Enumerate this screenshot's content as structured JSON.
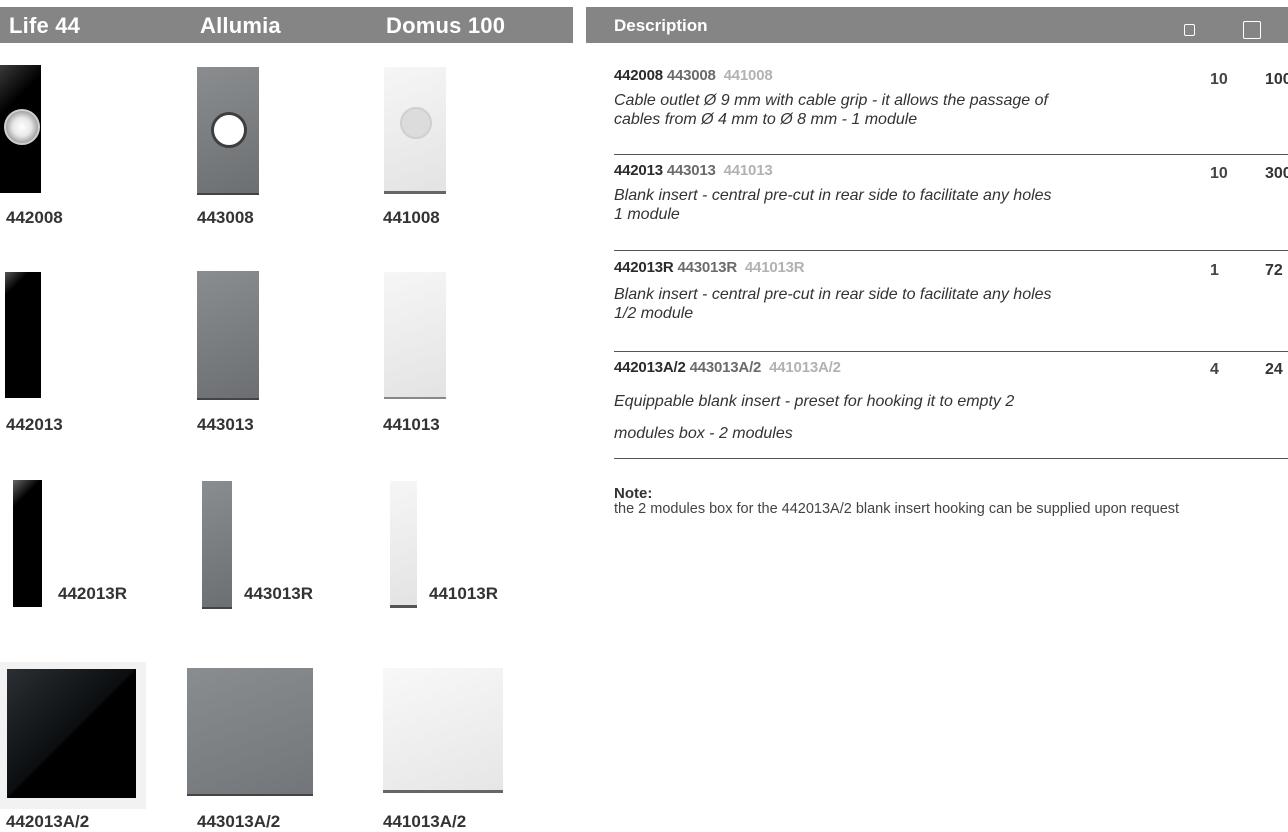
{
  "header": {
    "columns": [
      "Life 44",
      "Allumia",
      "Domus 100"
    ],
    "description_label": "Description",
    "qty_icons": [
      "small-box-icon",
      "large-box-icon"
    ],
    "bg_color": "#858585"
  },
  "products": [
    {
      "codes": [
        "442008",
        "443008",
        "441008"
      ],
      "description": [
        "Cable outlet Ø 9 mm with cable grip - it allows the passage of",
        "cables from Ø 4 mm to Ø 8 mm - 1 module"
      ],
      "qty_small": "10",
      "qty_large": "100"
    },
    {
      "codes": [
        "442013",
        "443013",
        "441013"
      ],
      "description": [
        "Blank insert - central pre-cut in rear side to facilitate any holes",
        "1 module"
      ],
      "qty_small": "10",
      "qty_large": "300"
    },
    {
      "codes": [
        "442013R",
        "443013R",
        "441013R"
      ],
      "description": [
        "Blank insert - central pre-cut in rear side to facilitate any holes",
        "1/2 module"
      ],
      "qty_small": "1",
      "qty_large": "72"
    },
    {
      "codes": [
        "442013A/2",
        "443013A/2",
        "441013A/2"
      ],
      "description": [
        "Equippable blank insert - preset for hooking it to empty 2",
        "modules box - 2 modules"
      ],
      "qty_small": "4",
      "qty_large": "24"
    }
  ],
  "note": {
    "title": "Note:",
    "text": "the 2 modules box for the 442013A/2 blank insert hooking can be supplied upon request"
  },
  "colors": {
    "life44": "#000000",
    "allumia": "#7b7e81",
    "domus100": "#e8e8e8"
  }
}
